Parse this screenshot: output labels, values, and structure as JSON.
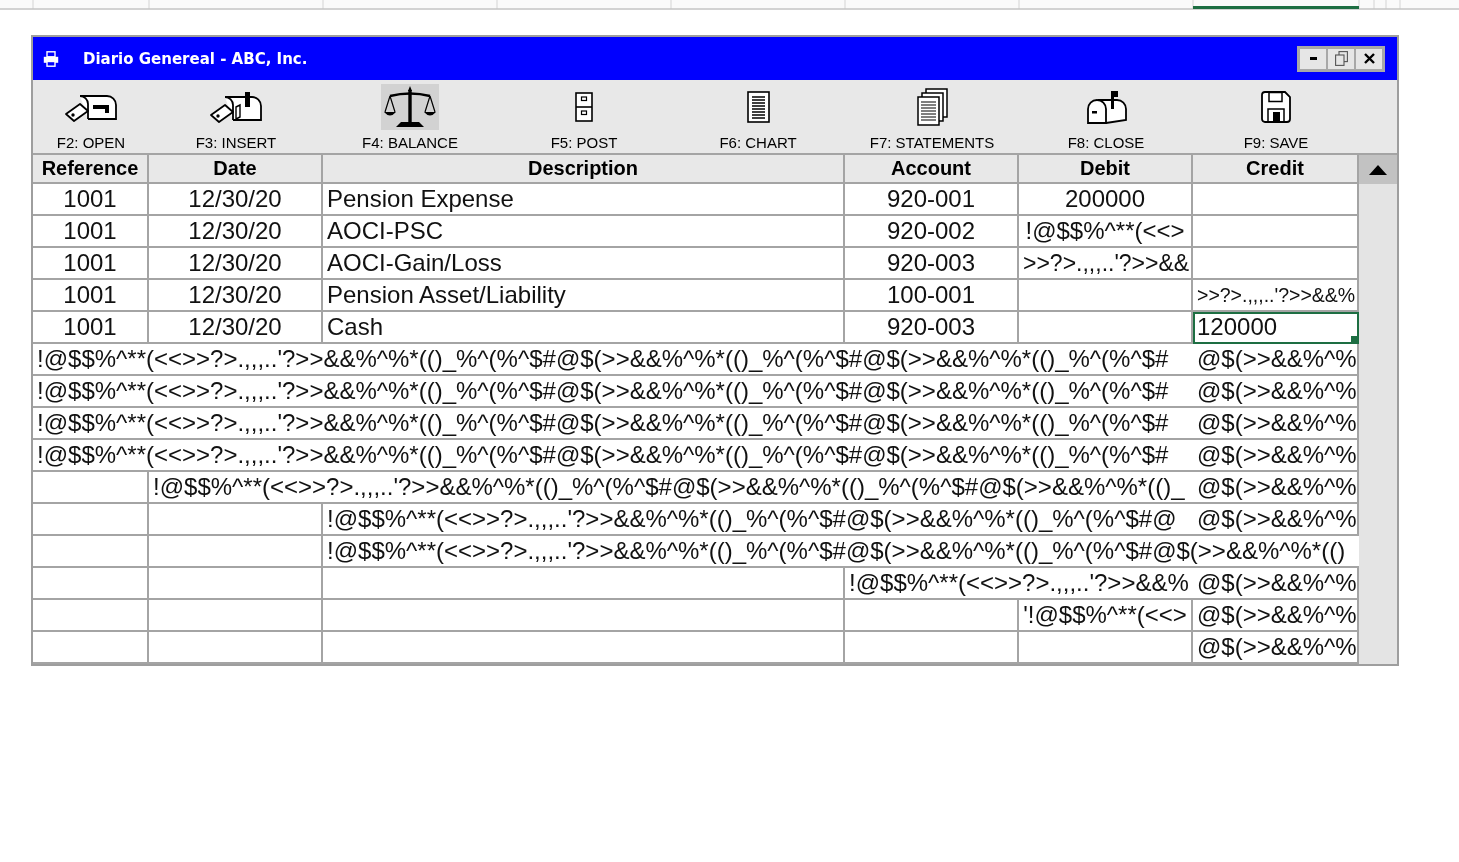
{
  "window": {
    "title": "Diario Genereal - ABC, Inc."
  },
  "toolbar": [
    {
      "label": "F2: OPEN",
      "selected": false
    },
    {
      "label": "F3: INSERT",
      "selected": false
    },
    {
      "label": "F4: BALANCE",
      "selected": true
    },
    {
      "label": "F5: POST",
      "selected": false
    },
    {
      "label": "F6: CHART",
      "selected": false
    },
    {
      "label": "F7: STATEMENTS",
      "selected": false
    },
    {
      "label": "F8: CLOSE",
      "selected": false
    },
    {
      "label": "F9: SAVE",
      "selected": false
    }
  ],
  "table": {
    "columns": [
      "Reference",
      "Date",
      "Description",
      "Account",
      "Debit",
      "Credit"
    ],
    "rows": [
      {
        "cells": [
          {
            "text": "1001",
            "selected": false
          },
          {
            "text": "12/30/20",
            "selected": false
          },
          {
            "text": "Pension Expense",
            "selected": false
          },
          {
            "text": "920-001",
            "selected": false
          },
          {
            "text": "200000",
            "selected": false
          },
          {
            "selected": false
          }
        ]
      },
      {
        "cells": [
          {
            "text": "1001",
            "selected": false
          },
          {
            "text": "12/30/20",
            "selected": false
          },
          {
            "text": "AOCI-PSC",
            "selected": false
          },
          {
            "text": "920-002",
            "selected": false
          },
          {
            "text": "!@$$%^**(<<>",
            "selected": false
          },
          {
            "selected": false
          }
        ]
      },
      {
        "cells": [
          {
            "text": "1001",
            "selected": false
          },
          {
            "text": "12/30/20",
            "selected": false
          },
          {
            "text": "AOCI-Gain/Loss",
            "selected": false
          },
          {
            "text": "920-003",
            "selected": false
          },
          {
            "text": ">>?>.,,,..'?>>&&",
            "selected": false
          },
          {
            "selected": false
          }
        ]
      },
      {
        "cells": [
          {
            "text": "1001",
            "selected": false
          },
          {
            "text": "12/30/20",
            "selected": false
          },
          {
            "text": "Pension Asset/Liability",
            "selected": false
          },
          {
            "text": "100-001",
            "selected": false
          },
          {
            "selected": false
          },
          {
            "text": ">>?>.,,,..'?>>&&%",
            "selected": false
          }
        ]
      },
      {
        "cells": [
          {
            "text": "1001",
            "selected": false
          },
          {
            "text": "12/30/20",
            "selected": false
          },
          {
            "text": "Cash",
            "selected": false
          },
          {
            "text": "920-003",
            "selected": false
          },
          {
            "selected": false
          },
          {
            "text": "120000",
            "selected": true
          }
        ]
      },
      {
        "cells": [
          {
            "text": "!@$$%^**(<<>>?>.,,,..'?>>&&%^%*(()_%^(%^$#@$(>>&&%^%*(()_%^(%^$#@$(>>&&%^%*(()_%^(%^$#",
            "selected": false
          },
          null,
          null,
          null,
          null,
          {
            "text": "@$(>>&&%^%",
            "selected": false
          }
        ]
      },
      {
        "cells": [
          {
            "text": "!@$$%^**(<<>>?>.,,,..'?>>&&%^%*(()_%^(%^$#@$(>>&&%^%*(()_%^(%^$#@$(>>&&%^%*(()_%^(%^$#",
            "selected": false
          },
          null,
          null,
          null,
          null,
          {
            "text": "@$(>>&&%^%",
            "selected": false
          }
        ]
      },
      {
        "cells": [
          {
            "text": "!@$$%^**(<<>>?>.,,,..'?>>&&%^%*(()_%^(%^$#@$(>>&&%^%*(()_%^(%^$#@$(>>&&%^%*(()_%^(%^$#",
            "selected": false
          },
          null,
          null,
          null,
          null,
          {
            "text": "@$(>>&&%^%",
            "selected": false
          }
        ]
      },
      {
        "cells": [
          {
            "text": "!@$$%^**(<<>>?>.,,,..'?>>&&%^%*(()_%^(%^$#@$(>>&&%^%*(()_%^(%^$#@$(>>&&%^%*(()_%^(%^$#",
            "selected": false
          },
          null,
          null,
          null,
          null,
          {
            "text": "@$(>>&&%^%",
            "selected": false
          }
        ]
      },
      {
        "cells": [
          {
            "selected": false
          },
          {
            "text": "!@$$%^**(<<>>?>.,,,..'?>>&&%^%*(()_%^(%^$#@$(>>&&%^%*(()_%^(%^$#@$(>>&&%^%*(()_",
            "selected": false
          },
          null,
          null,
          null,
          {
            "text": "@$(>>&&%^%",
            "selected": false
          }
        ]
      },
      {
        "cells": [
          {
            "selected": false
          },
          {
            "selected": false
          },
          {
            "text": "!@$$%^**(<<>>?>.,,,..'?>>&&%^%*(()_%^(%^$#@$(>>&&%^%*(()_%^(%^$#@",
            "selected": false
          },
          null,
          null,
          {
            "text": "@$(>>&&%^%",
            "selected": false
          }
        ]
      },
      {
        "cells": [
          {
            "selected": false
          },
          {
            "selected": false
          },
          {
            "text": "!@$$%^**(<<>>?>.,,,..'?>>&&%^%*(()_%^(%^$#@$(>>&&%^%*(()_%^(%^$#@$(>>&&%^%*(()",
            "selected": false
          },
          null,
          null,
          null
        ]
      },
      {
        "cells": [
          {
            "selected": false
          },
          {
            "selected": false
          },
          {
            "selected": false
          },
          {
            "text": "!@$$%^**(<<>>?>.,,,..'?>>&&%",
            "selected": false
          },
          null,
          {
            "text": "@$(>>&&%^%",
            "selected": false
          }
        ]
      },
      {
        "cells": [
          {
            "selected": false
          },
          {
            "selected": false
          },
          {
            "selected": false
          },
          {
            "selected": false
          },
          {
            "text": "'!@$$%^**(<<>",
            "selected": false
          },
          {
            "text": "@$(>>&&%^%",
            "selected": false
          }
        ]
      },
      {
        "cells": [
          {
            "selected": false
          },
          {
            "selected": false
          },
          {
            "selected": false
          },
          {
            "selected": false
          },
          {
            "selected": false
          },
          {
            "text": "@$(>>&&%^%",
            "selected": false
          }
        ]
      }
    ]
  }
}
